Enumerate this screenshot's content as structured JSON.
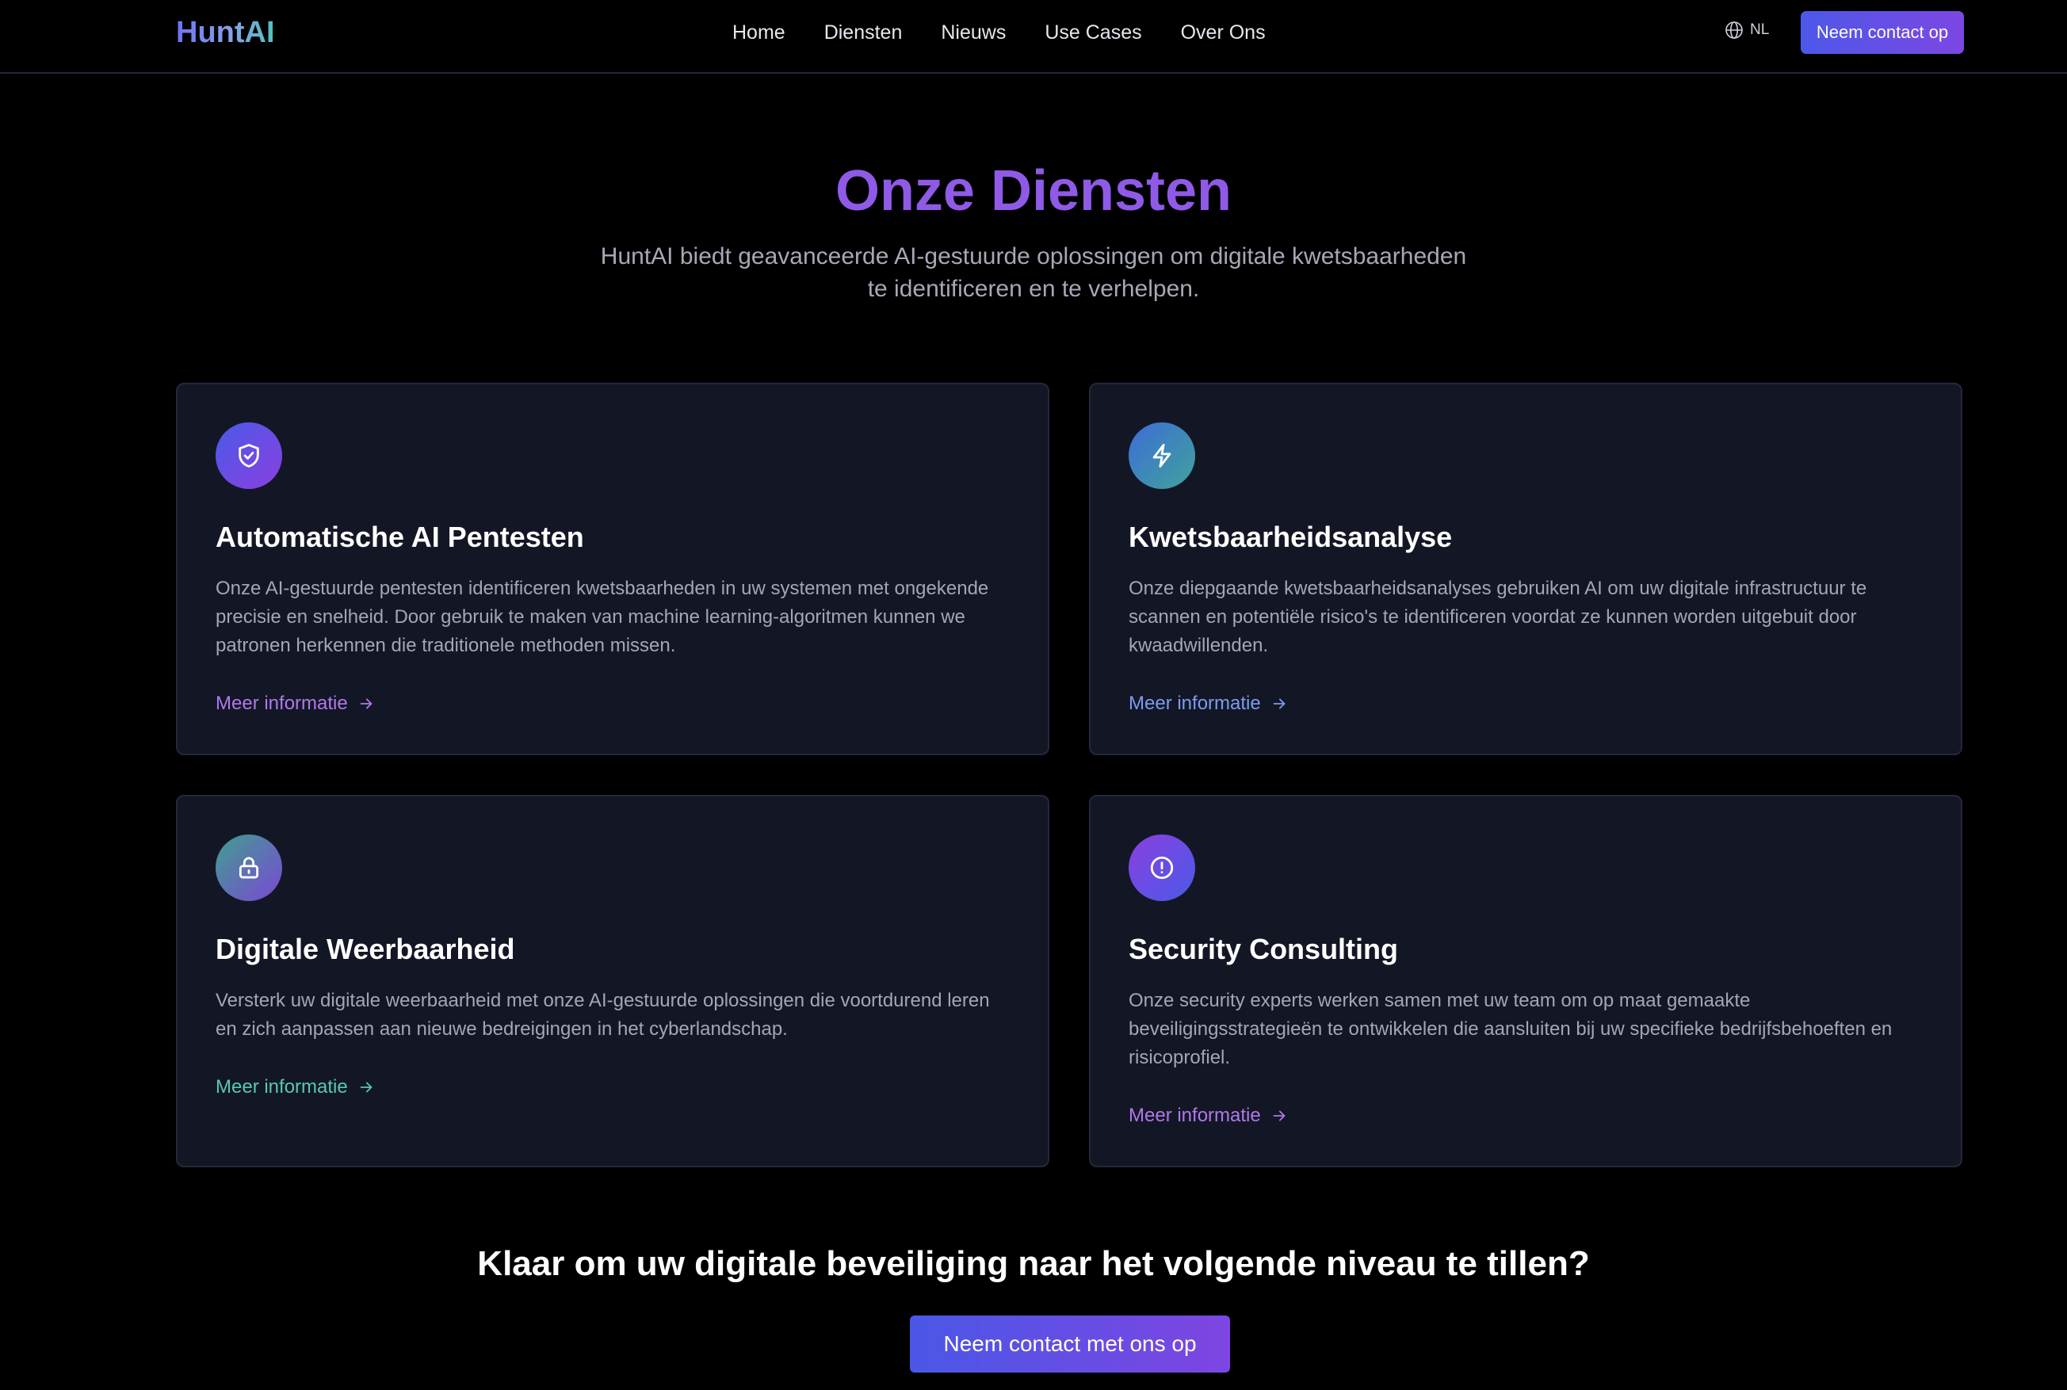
{
  "header": {
    "logo": "HuntAI",
    "nav": [
      "Home",
      "Diensten",
      "Nieuws",
      "Use Cases",
      "Over Ons"
    ],
    "language": "NL",
    "language_icon": "globe-icon",
    "cta_label": "Neem contact op"
  },
  "hero": {
    "title": "Onze Diensten",
    "subtitle": "HuntAI biedt geavanceerde AI-gestuurde oplossingen om digitale kwetsbaarheden te identificeren en te verhelpen."
  },
  "services": [
    {
      "icon": "shield-check-icon",
      "title": "Automatische AI Pentesten",
      "description": "Onze AI-gestuurde pentesten identificeren kwetsbaarheden in uw systemen met ongekende precisie en snelheid. Door gebruik te maken van machine learning-algoritmen kunnen we patronen herkennen die traditionele methoden missen.",
      "link": "Meer informatie"
    },
    {
      "icon": "lightning-icon",
      "title": "Kwetsbaarheidsanalyse",
      "description": "Onze diepgaande kwetsbaarheidsanalyses gebruiken AI om uw digitale infrastructuur te scannen en potentiële risico's te identificeren voordat ze kunnen worden uitgebuit door kwaadwillenden.",
      "link": "Meer informatie"
    },
    {
      "icon": "lock-icon",
      "title": "Digitale Weerbaarheid",
      "description": "Versterk uw digitale weerbaarheid met onze AI-gestuurde oplossingen die voortdurend leren en zich aanpassen aan nieuwe bedreigingen in het cyberlandschap.",
      "link": "Meer informatie"
    },
    {
      "icon": "alert-circle-icon",
      "title": "Security Consulting",
      "description": "Onze security experts werken samen met uw team om op maat gemaakte beveiligingsstrategieën te ontwikkelen die aansluiten bij uw specifieke bedrijfsbehoeften en risicoprofiel.",
      "link": "Meer informatie"
    }
  ],
  "cta": {
    "title": "Klaar om uw digitale beveiliging naar het volgende niveau te tillen?",
    "button": "Neem contact met ons op"
  },
  "colors": {
    "accent_purple": "#8f5ae6",
    "accent_blue": "#4d58e8",
    "card_background": "#131725",
    "link_purple": "#b078ec",
    "link_blue": "#7d9bf0",
    "link_teal": "#57c9b2"
  }
}
